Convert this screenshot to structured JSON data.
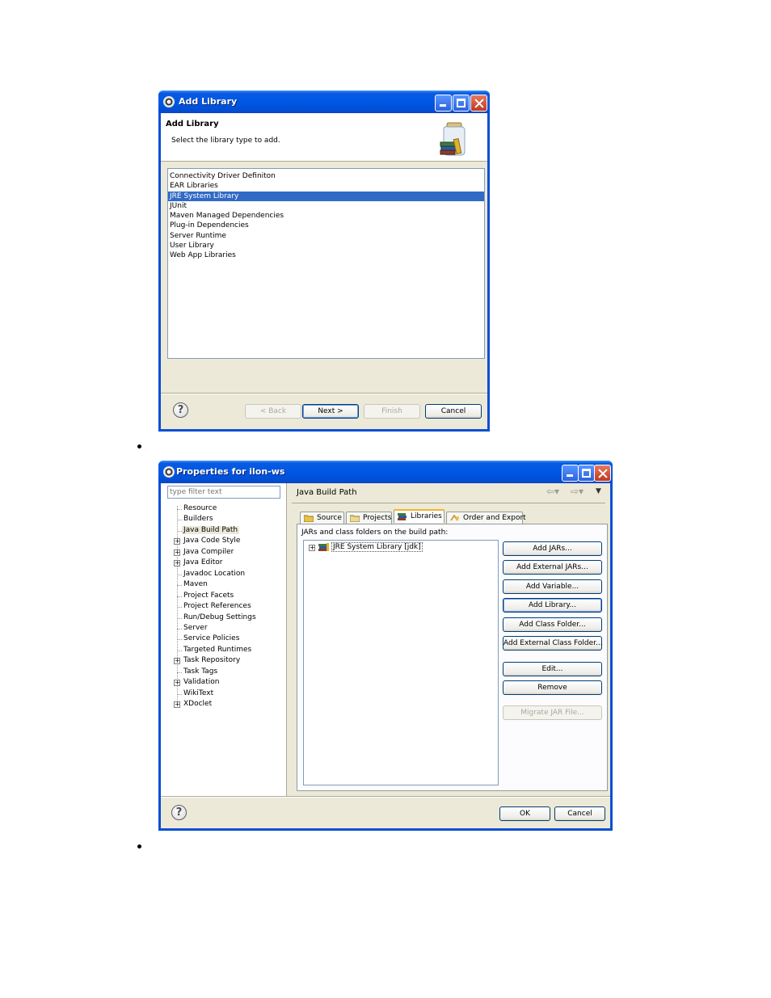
{
  "add_library": {
    "title": "Add Library",
    "header_title": "Add Library",
    "header_desc": "Select the library type to add.",
    "items": [
      "Connectivity Driver Definiton",
      "EAR Libraries",
      "JRE System Library",
      "JUnit",
      "Maven Managed Dependencies",
      "Plug-in Dependencies",
      "Server Runtime",
      "User Library",
      "Web App Libraries"
    ],
    "selected_item": "JRE System Library",
    "buttons": {
      "back": "< Back",
      "next": "Next >",
      "finish": "Finish",
      "cancel": "Cancel"
    }
  },
  "properties": {
    "title": "Properties for ilon-ws",
    "filter_placeholder": "type filter text",
    "tree": [
      {
        "label": "Resource",
        "expandable": false
      },
      {
        "label": "Builders",
        "expandable": false
      },
      {
        "label": "Java Build Path",
        "expandable": false
      },
      {
        "label": "Java Code Style",
        "expandable": true
      },
      {
        "label": "Java Compiler",
        "expandable": true
      },
      {
        "label": "Java Editor",
        "expandable": true
      },
      {
        "label": "Javadoc Location",
        "expandable": false
      },
      {
        "label": "Maven",
        "expandable": false
      },
      {
        "label": "Project Facets",
        "expandable": false
      },
      {
        "label": "Project References",
        "expandable": false
      },
      {
        "label": "Run/Debug Settings",
        "expandable": false
      },
      {
        "label": "Server",
        "expandable": false
      },
      {
        "label": "Service Policies",
        "expandable": false
      },
      {
        "label": "Targeted Runtimes",
        "expandable": false
      },
      {
        "label": "Task Repository",
        "expandable": true
      },
      {
        "label": "Task Tags",
        "expandable": false
      },
      {
        "label": "Validation",
        "expandable": true
      },
      {
        "label": "WikiText",
        "expandable": false
      },
      {
        "label": "XDoclet",
        "expandable": true
      }
    ],
    "selected_tree_item": "Java Build Path",
    "page_title": "Java Build Path",
    "tabs": [
      "Source",
      "Projects",
      "Libraries",
      "Order and Export"
    ],
    "active_tab": "Libraries",
    "jars_label": "JARs and class folders on the build path:",
    "libraries": [
      "JRE System Library [jdk]"
    ],
    "side_buttons": {
      "add_jars": "Add JARs...",
      "add_external_jars": "Add External JARs...",
      "add_variable": "Add Variable...",
      "add_library": "Add Library...",
      "add_class_folder": "Add Class Folder...",
      "add_external_class_folder": "Add External Class Folder...",
      "edit": "Edit...",
      "remove": "Remove",
      "migrate_jar": "Migrate JAR File..."
    },
    "bottom_buttons": {
      "ok": "OK",
      "cancel": "Cancel"
    }
  },
  "colors": {
    "titlebar": "#0058e6",
    "selection": "#316ac5",
    "dialog_bg": "#ece9d8",
    "active_tab_accent": "#f9b030"
  }
}
